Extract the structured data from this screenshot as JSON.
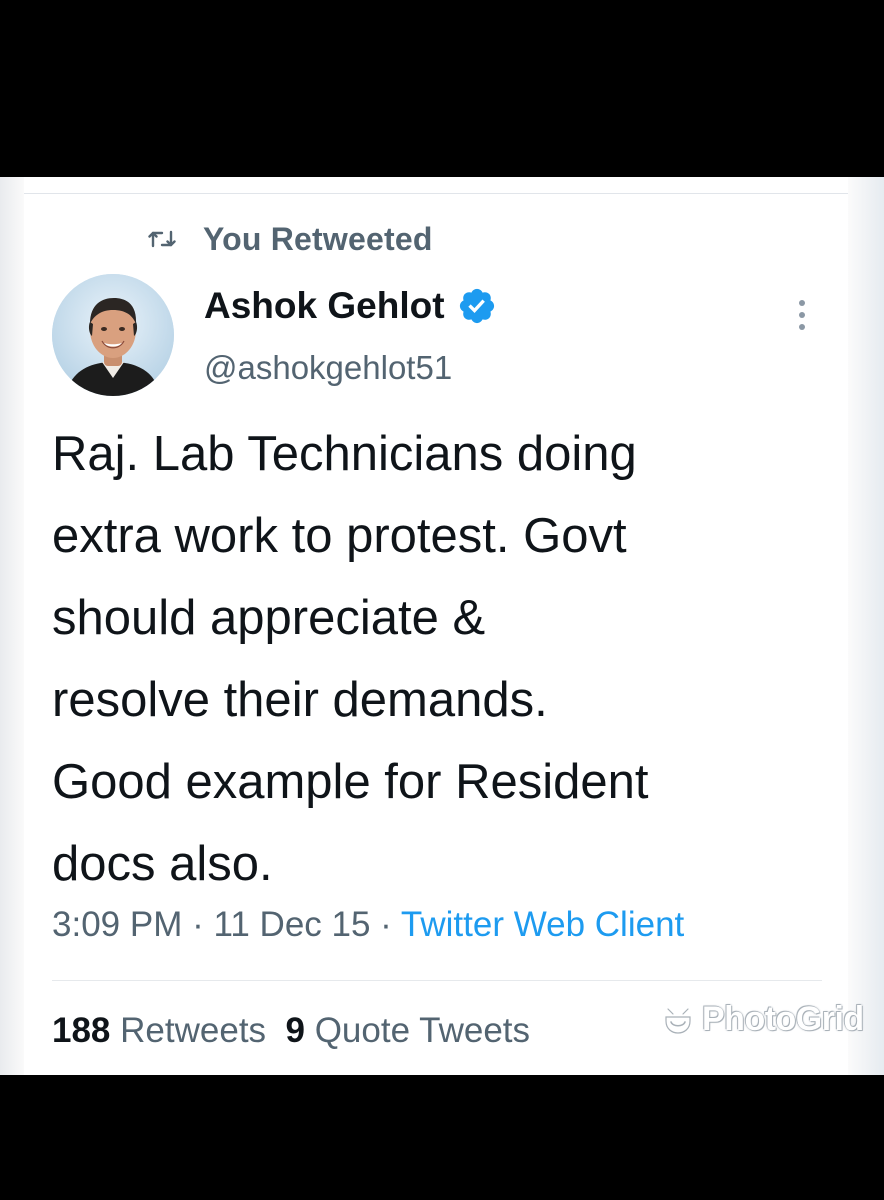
{
  "retweet_context": {
    "icon": "retweet-icon",
    "label": "You Retweeted"
  },
  "author": {
    "name": "Ashok Gehlot",
    "handle": "@ashokgehlot51",
    "verified": true,
    "verified_icon": "verified-badge-icon",
    "avatar": "profile-photo"
  },
  "tweet": {
    "text": "Raj. Lab Technicians doing\nextra work to protest. Govt\nshould appreciate &\nresolve their demands.\nGood example for Resident\ndocs also.",
    "time": "3:09 PM",
    "separator": "·",
    "date": "11 Dec 15",
    "source": "Twitter Web Client"
  },
  "stats": {
    "retweets_count": "188",
    "retweets_label": "Retweets",
    "quotes_count": "9",
    "quotes_label": "Quote Tweets"
  },
  "watermark": {
    "text": "PhotoGrid",
    "icon": "photogrid-icon"
  },
  "colors": {
    "primary_text": "#0f1419",
    "secondary_text": "#536471",
    "link": "#1d9bf0",
    "verified": "#1d9bf0",
    "background": "#000000",
    "card": "#ffffff"
  }
}
